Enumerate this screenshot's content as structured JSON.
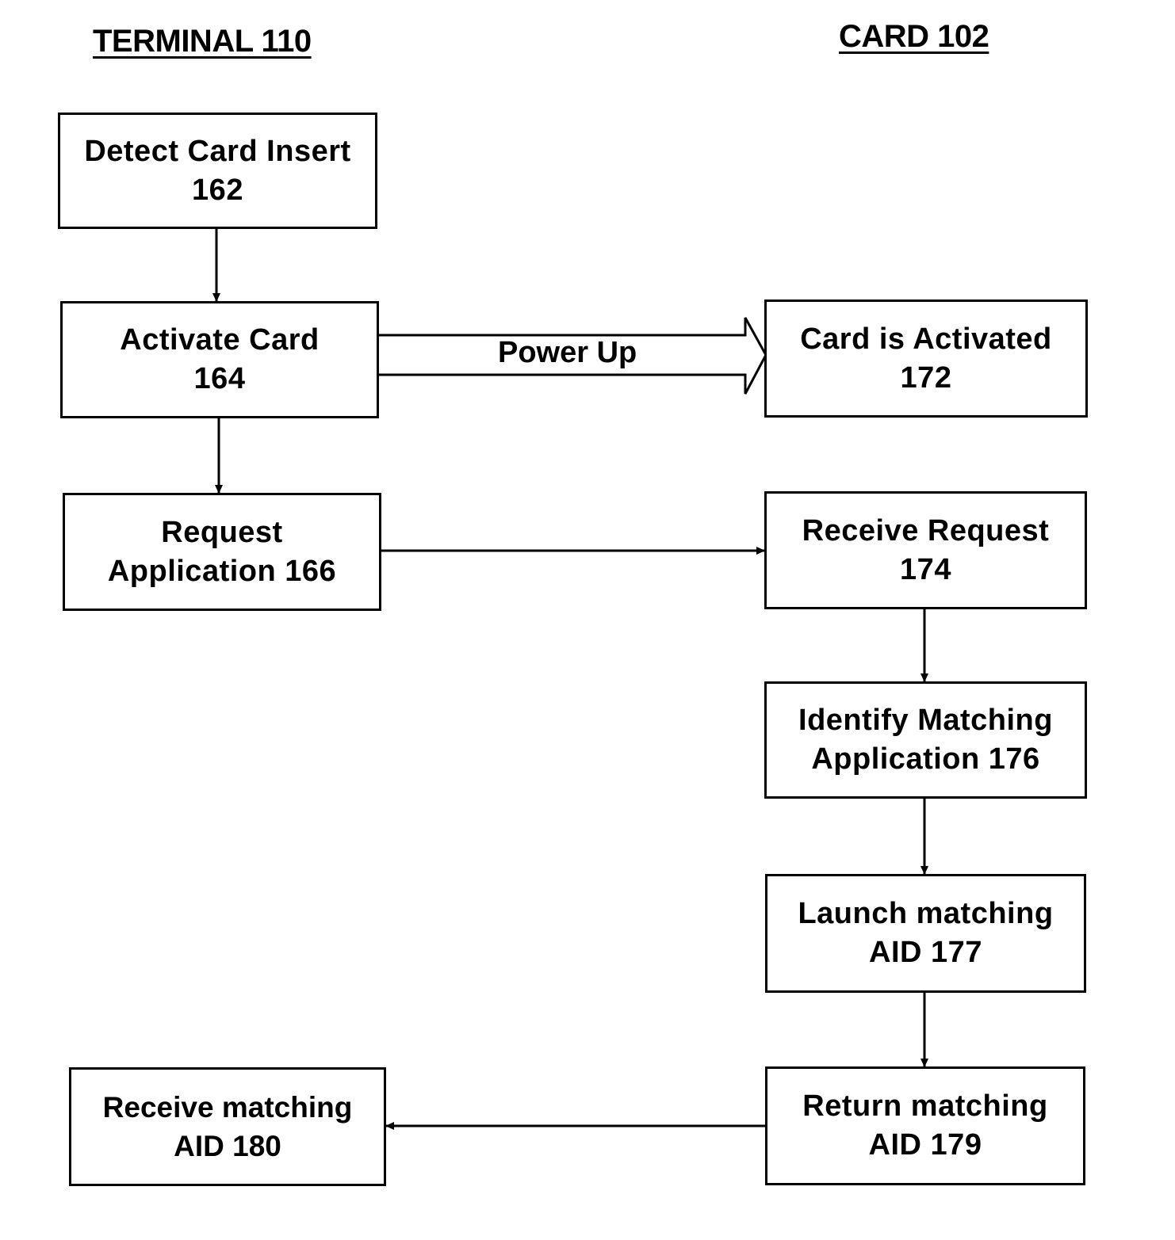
{
  "columns": {
    "terminal": {
      "title": "TERMINAL 110"
    },
    "card": {
      "title": "CARD 102"
    }
  },
  "nodes": {
    "n162": {
      "line1": "Detect Card Insert",
      "line2": "162"
    },
    "n164": {
      "line1": "Activate Card",
      "line2": "164"
    },
    "n166": {
      "line1": "Request",
      "line2": "Application 166"
    },
    "n172": {
      "line1": "Card is Activated",
      "line2": "172"
    },
    "n174": {
      "line1": "Receive Request",
      "line2": "174"
    },
    "n176": {
      "line1": "Identify Matching",
      "line2": "Application 176"
    },
    "n177": {
      "line1": "Launch matching",
      "line2": "AID 177"
    },
    "n179": {
      "line1": "Return matching",
      "line2": "AID 179"
    },
    "n180": {
      "line1": "Receive matching",
      "line2": "AID 180"
    }
  },
  "edges": [
    {
      "from": "162",
      "to": "164",
      "kind": "arrow"
    },
    {
      "from": "164",
      "to": "166",
      "kind": "arrow"
    },
    {
      "from": "164",
      "to": "172",
      "kind": "block-arrow",
      "label": "Power Up"
    },
    {
      "from": "166",
      "to": "174",
      "kind": "arrow"
    },
    {
      "from": "174",
      "to": "176",
      "kind": "arrow"
    },
    {
      "from": "176",
      "to": "177",
      "kind": "arrow"
    },
    {
      "from": "177",
      "to": "179",
      "kind": "arrow"
    },
    {
      "from": "179",
      "to": "180",
      "kind": "arrow"
    }
  ],
  "edge_labels": {
    "power_up": "Power Up"
  }
}
